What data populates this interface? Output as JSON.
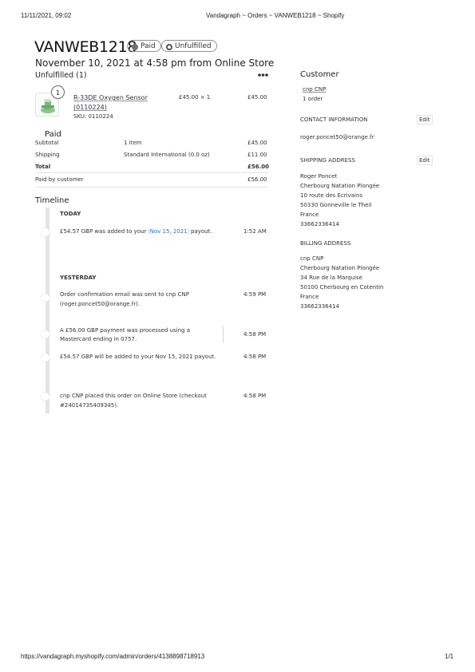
{
  "print_header": {
    "timestamp": "11/11/2021, 09:02",
    "title": "Vandagraph ~ Orders ~ VANWEB1218 ~ Shopify"
  },
  "print_footer": {
    "url": "https://vandagraph.myshopify.com/admin/orders/4138898718913",
    "page": "1/1"
  },
  "order": {
    "number": "VANWEB1218",
    "badges": {
      "paid": "Paid",
      "unfulfilled": "Unfulfilled"
    },
    "date_line": "November 10, 2021 at 4:58 pm from Online Store"
  },
  "fulfillment": {
    "heading": "Unfulfilled (1)",
    "quantity_badge": "1",
    "item": {
      "name": "R-33DE Oxygen Sensor",
      "variant": "(0110224)",
      "sku": "SKU: 0110224",
      "unit_price": "£45.00 × 1",
      "total": "£45.00"
    }
  },
  "payment": {
    "heading": "Paid",
    "rows": {
      "subtotal": {
        "label": "Subtotal",
        "desc": "1 item",
        "amount": "£45.00"
      },
      "shipping": {
        "label": "Shipping",
        "desc": "Standard International (0.0 oz)",
        "amount": "£11.00"
      },
      "total": {
        "label": "Total",
        "amount": "£56.00"
      },
      "paid_by_customer": {
        "label": "Paid by customer",
        "amount": "£56.00"
      }
    }
  },
  "timeline": {
    "heading": "Timeline",
    "today_label": "TODAY",
    "yesterday_label": "YESTERDAY",
    "payout_event": {
      "before": "£54.57 GBP was added to your",
      "link": "Nov 15, 2021",
      "after": "payout.",
      "time": "1:52 AM"
    },
    "events": {
      "confirmation": {
        "line1": "Order confirmation email was sent to cnp CNP",
        "line2": "(roger.poncet50@orange.fr).",
        "time": "4:59 PM"
      },
      "payment": {
        "line1": "A £56.00 GBP payment was processed using a",
        "line2": "Mastercard ending in 0757.",
        "time": "4:58 PM"
      },
      "payout_pending": {
        "line1": "£54.57 GBP will be added to your Nov 15, 2021 payout.",
        "time": "4:58 PM"
      },
      "placed": {
        "line1": "cnp CNP placed this order on Online Store (checkout",
        "line2": "#24014735409345).",
        "time": "4:58 PM"
      }
    }
  },
  "customer": {
    "heading": "Customer",
    "name": "cnp CNP",
    "orders": "1 order",
    "contact_heading": "CONTACT INFORMATION",
    "edit_label": "Edit",
    "email": "roger.poncet50@orange.fr",
    "shipping_heading": "SHIPPING ADDRESS",
    "shipping_lines": [
      "Roger Poncet",
      "Cherbourg Natation Plongée",
      "10 route des Ecrivains",
      "50330 Gonneville le Theil",
      "France",
      "33662336414"
    ],
    "billing_heading": "BILLING ADDRESS",
    "billing_lines": [
      "cnp CNP",
      "Cherbourg Natation Plongée",
      "34 Rue de la Marquise",
      "50100 Cherbourg en Cotentin",
      "France",
      "33662336414"
    ]
  },
  "colors": {
    "link": "#2c6ecb",
    "paid_dot": "#6d7175",
    "rail": "#e4e5e7"
  }
}
